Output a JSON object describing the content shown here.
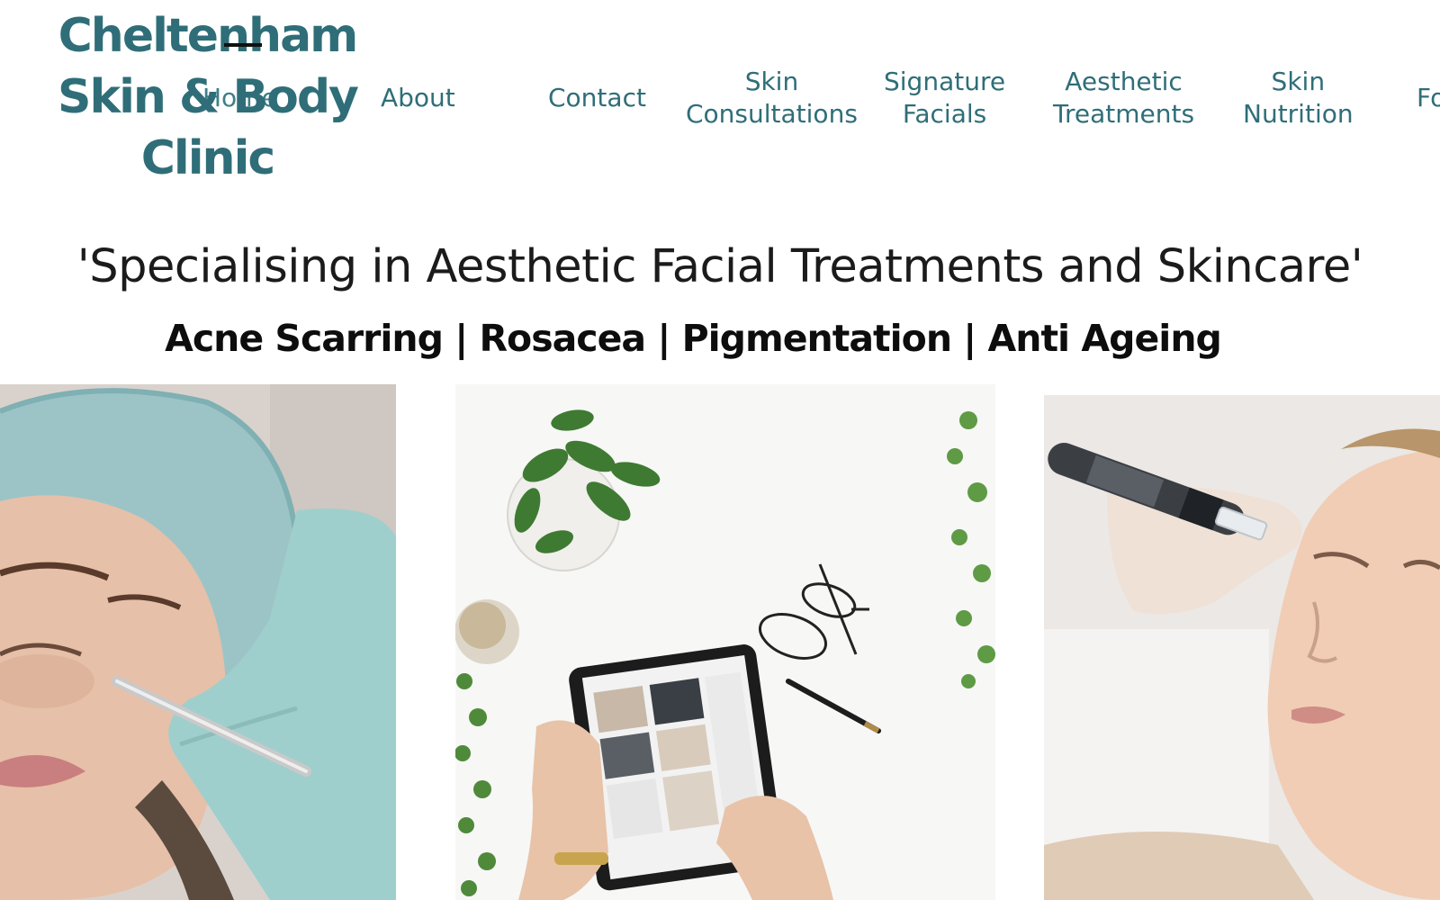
{
  "logo": {
    "line1": "Cheltenham",
    "line2": "Skin & Body",
    "line3": "Clinic"
  },
  "nav": {
    "home": "Home",
    "about": "About",
    "contact": "Contact",
    "skin_consultations": [
      "Skin",
      "Consultations"
    ],
    "signature_facials": [
      "Signature",
      "Facials"
    ],
    "aesthetic_treatments": [
      "Aesthetic",
      "Treatments"
    ],
    "skin_nutrition": [
      "Skin",
      "Nutrition"
    ],
    "more": "Fo"
  },
  "hero": {
    "tagline": "'Specialising in Aesthetic Facial Treatments and Skincare'",
    "conditions": "Acne Scarring | Rosacea | Pigmentation | Anti Ageing"
  },
  "colors": {
    "brand": "#2f6e78",
    "text": "#1b1b1b"
  }
}
